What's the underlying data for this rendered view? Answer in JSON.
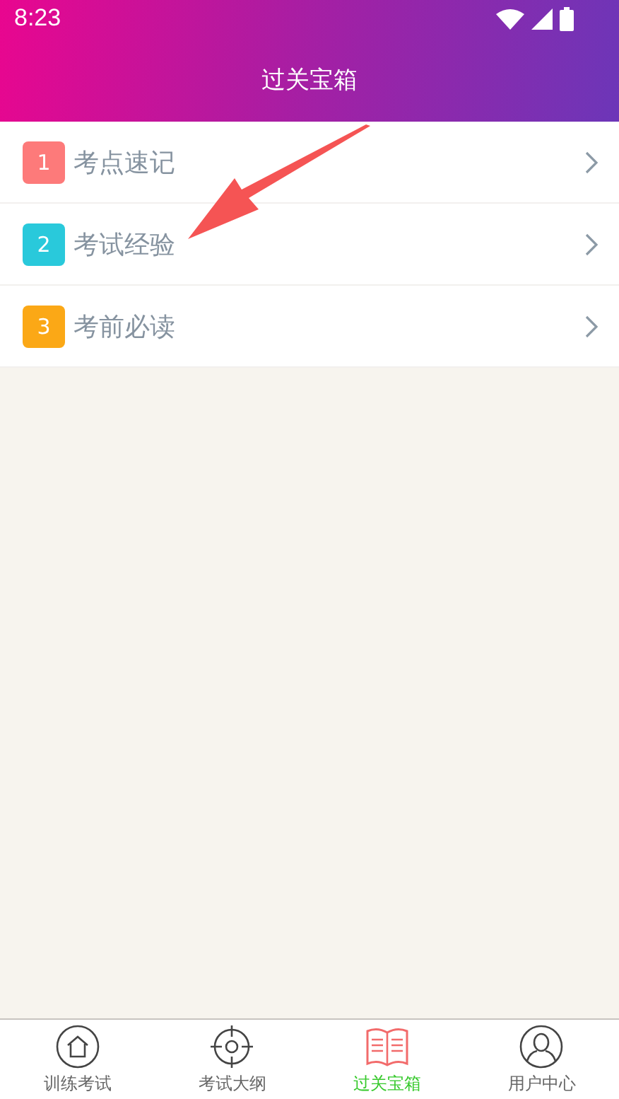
{
  "status_bar": {
    "time": "8:23"
  },
  "header": {
    "title": "过关宝箱"
  },
  "items": [
    {
      "number": "1",
      "label": "考点速记",
      "color": "#fd7a7a"
    },
    {
      "number": "2",
      "label": "考试经验",
      "color": "#29c9db"
    },
    {
      "number": "3",
      "label": "考前必读",
      "color": "#fba816"
    }
  ],
  "annotation": {
    "kind": "arrow"
  },
  "tabs": [
    {
      "label": "训练考试",
      "kind": "home",
      "selected": false
    },
    {
      "label": "考试大纲",
      "kind": "target",
      "selected": false
    },
    {
      "label": "过关宝箱",
      "kind": "book",
      "selected": true
    },
    {
      "label": "用户中心",
      "kind": "user",
      "selected": false
    }
  ]
}
